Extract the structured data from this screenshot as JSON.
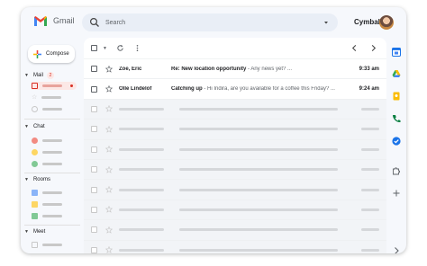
{
  "app": {
    "name": "Gmail",
    "brand": "Cymbal"
  },
  "search": {
    "placeholder": "Search"
  },
  "compose": {
    "label": "Compose"
  },
  "nav": {
    "mail": {
      "label": "Mail",
      "badge": "2"
    },
    "chat": {
      "label": "Chat"
    },
    "rooms": {
      "label": "Rooms"
    },
    "meet": {
      "label": "Meet"
    }
  },
  "emails": [
    {
      "sender": "Zoe, Eric",
      "subject": "Re: New location opportunity",
      "snippet": " - Any news yet? ...",
      "time": "9:33 am"
    },
    {
      "sender": "Olle Lindelof",
      "subject": "Catching up",
      "snippet": " - Hi Indira, are you available for a coffee this Friday? ...",
      "time": "9:24 am"
    }
  ],
  "colors": {
    "accent": "#d93025",
    "selected_bg": "#fce8e6",
    "window_bg": "#f6f8fc"
  },
  "icons": [
    "search-icon",
    "plus-icon",
    "refresh-icon",
    "more-vert-icon",
    "chevron-left-icon",
    "chevron-right-icon",
    "star-icon",
    "calendar-icon",
    "drive-icon",
    "keep-icon",
    "phone-icon",
    "tasks-icon",
    "puzzle-icon",
    "add-icon"
  ]
}
